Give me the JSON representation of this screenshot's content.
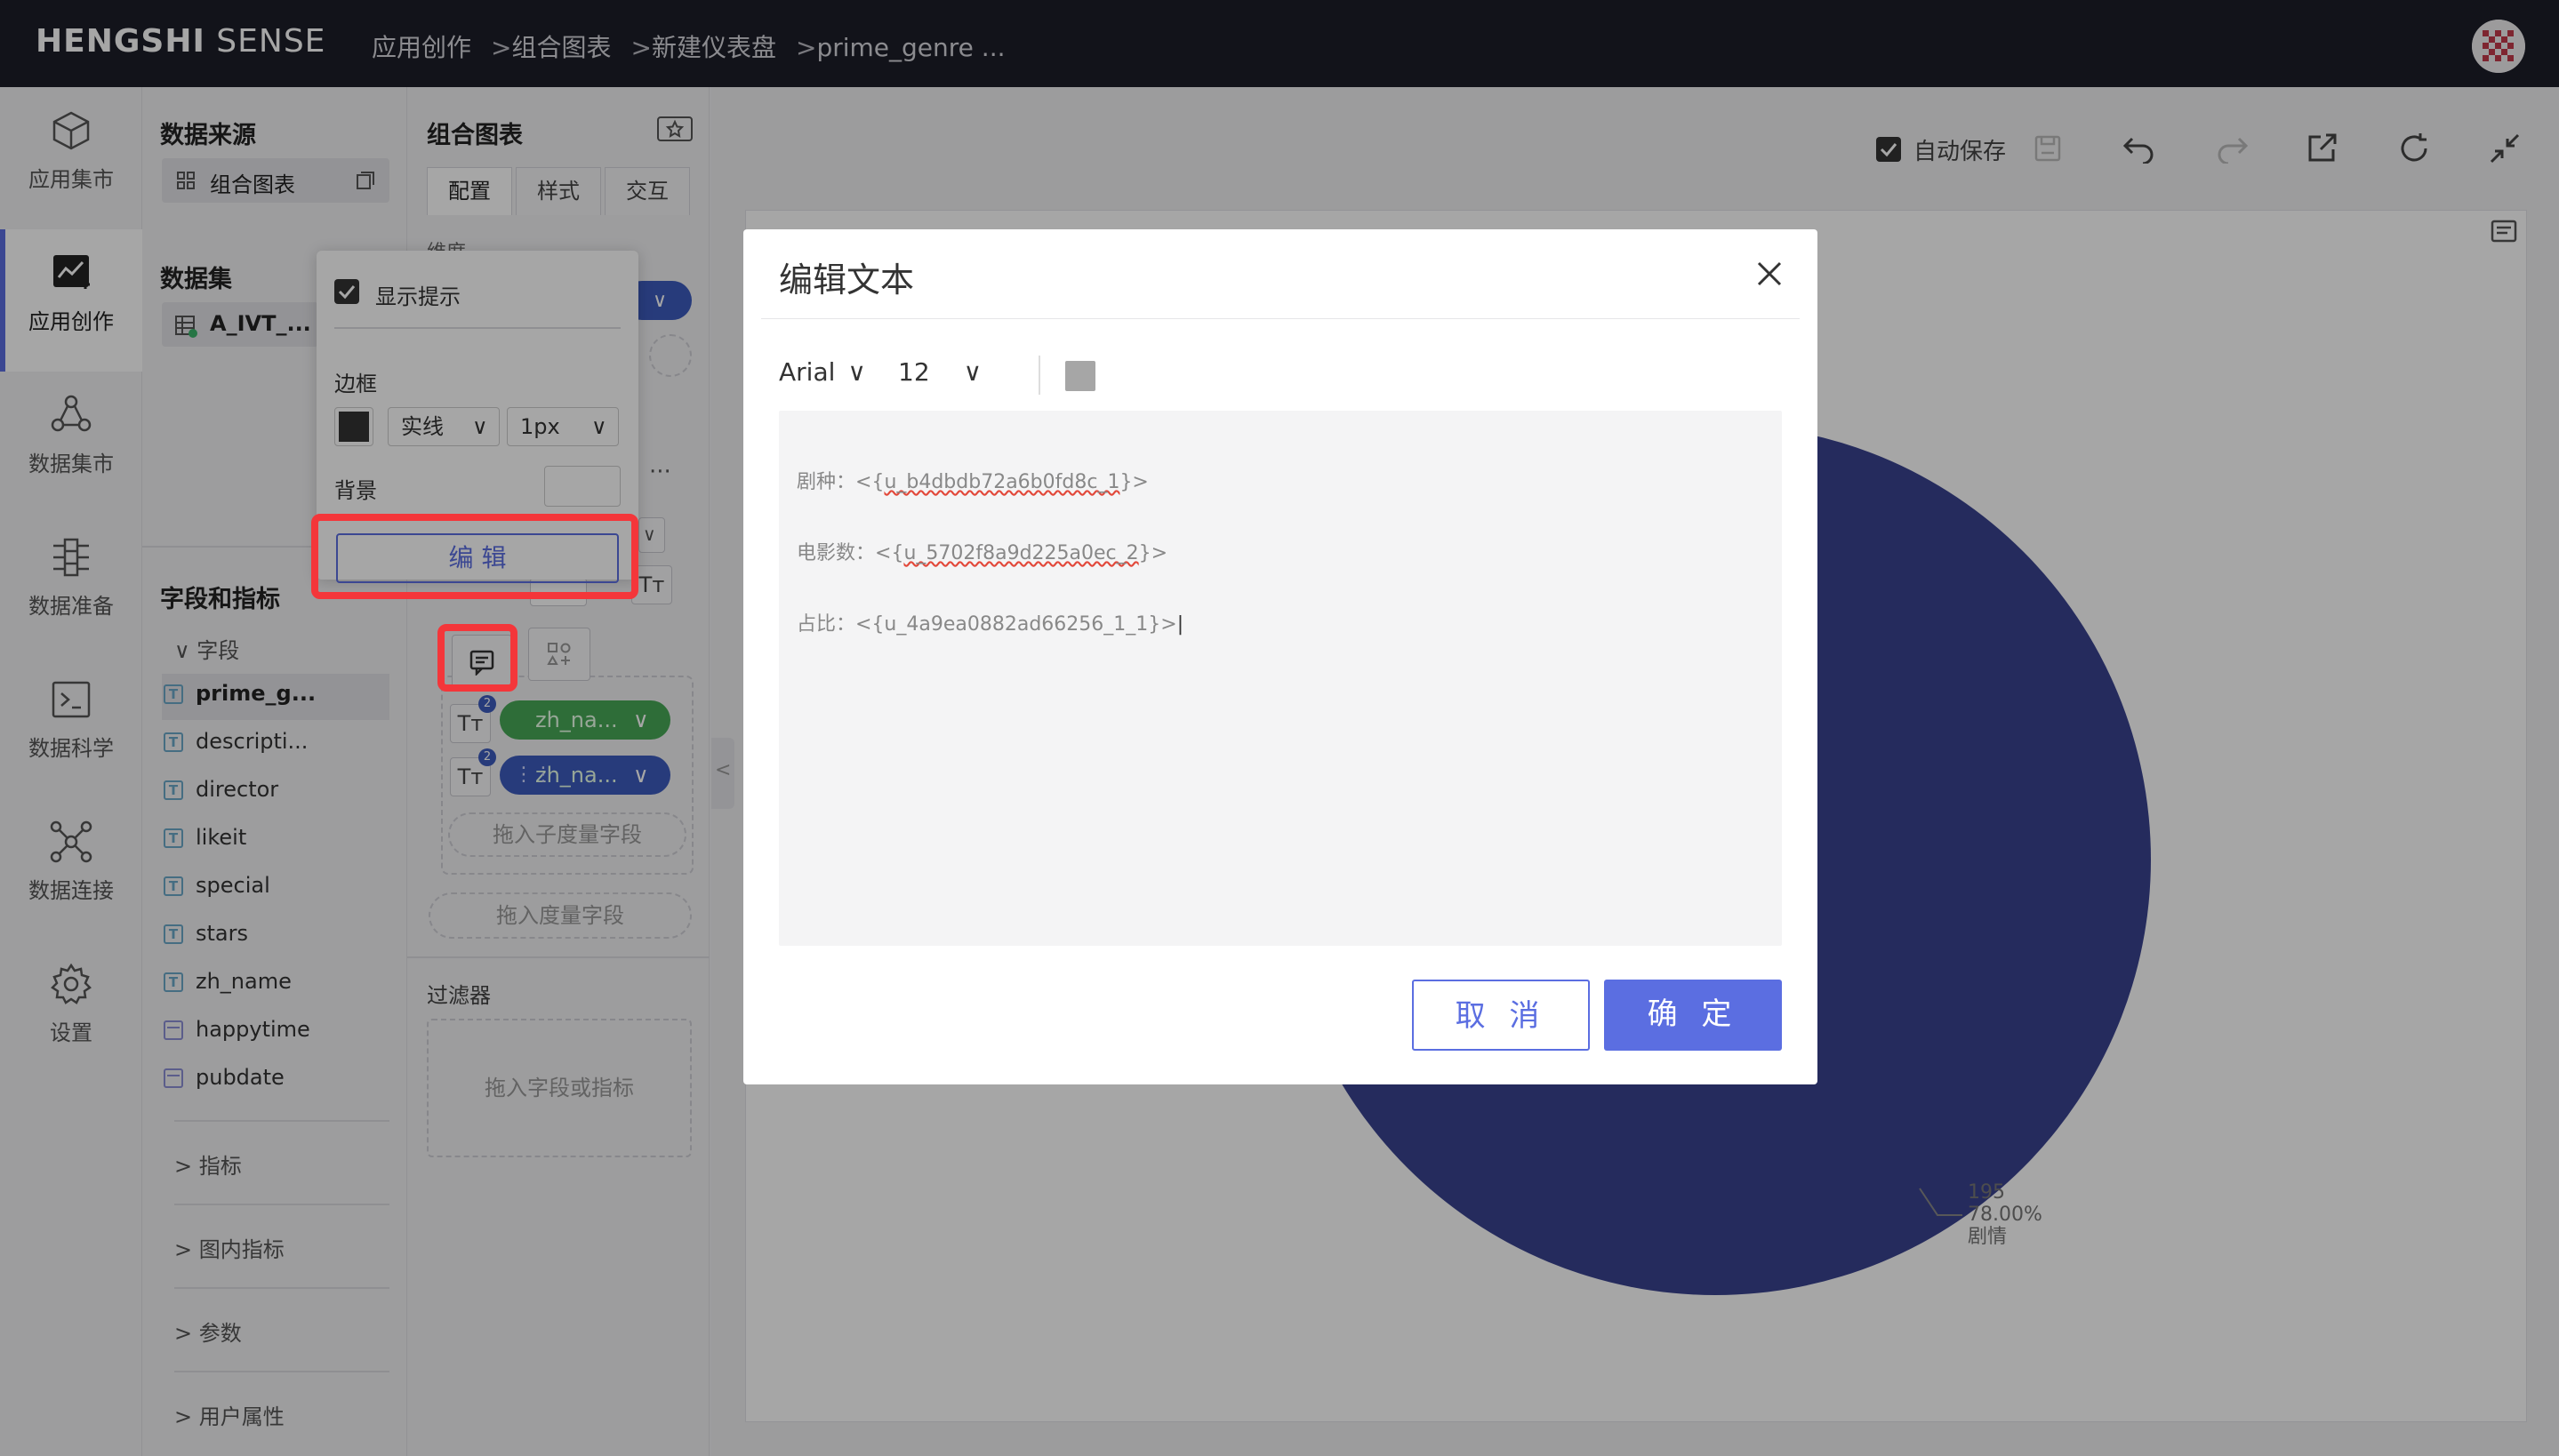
{
  "app": {
    "logo_bold": "HENGSHI",
    "logo_light": " SENSE"
  },
  "breadcrumbs": [
    "应用创作",
    "组合图表",
    "新建仪表盘",
    "prime_genre ..."
  ],
  "breadcrumb_sep": ">",
  "leftnav": {
    "items": [
      {
        "label": "应用集市",
        "icon": "cube-icon"
      },
      {
        "label": "应用创作",
        "icon": "chart-edit-icon",
        "active": true
      },
      {
        "label": "数据集市",
        "icon": "network-icon"
      },
      {
        "label": "数据准备",
        "icon": "data-prep-icon"
      },
      {
        "label": "数据科学",
        "icon": "terminal-icon"
      },
      {
        "label": "数据连接",
        "icon": "connection-icon"
      },
      {
        "label": "设置",
        "icon": "gear-icon"
      }
    ]
  },
  "datapanel": {
    "source_title": "数据来源",
    "source_value": "组合图表",
    "dataset_title": "数据集",
    "dataset_value": "A_IVT_...",
    "fields_title": "字段和指标",
    "fields_group": "字段",
    "fields": [
      {
        "name": "prime_g...",
        "type": "T",
        "selected": true
      },
      {
        "name": "descripti...",
        "type": "T"
      },
      {
        "name": "director",
        "type": "T"
      },
      {
        "name": "likeit",
        "type": "T"
      },
      {
        "name": "special",
        "type": "T"
      },
      {
        "name": "stars",
        "type": "T"
      },
      {
        "name": "zh_name",
        "type": "T"
      },
      {
        "name": "happytime",
        "type": "date"
      },
      {
        "name": "pubdate",
        "type": "date"
      }
    ],
    "groups": [
      "指标",
      "图内指标",
      "参数",
      "用户属性"
    ]
  },
  "cfgpanel": {
    "title": "组合图表",
    "tabs": [
      "配置",
      "样式",
      "交互"
    ],
    "dim_label_partial": "维度",
    "pill_green": "zh_na...",
    "pill_blue": "zh_na...",
    "badge": "2",
    "drop_sub_measure": "拖入子度量字段",
    "drop_measure": "拖入度量字段",
    "filter_title": "过滤器",
    "drop_filter": "拖入字段或指标",
    "more": "···"
  },
  "popover": {
    "show_tip": "显示提示",
    "border_label": "边框",
    "border_style": "实线",
    "border_width": "1px",
    "bg_label": "背景",
    "edit_btn": "编 辑"
  },
  "toolbar": {
    "autosave": "自动保存"
  },
  "chart": {
    "label_value": "195",
    "label_percent": "78.00%",
    "label_name": "剧情",
    "pie_color": "#3a4390"
  },
  "modal": {
    "title": "编辑文本",
    "font": "Arial",
    "size": "12",
    "color_swatch": "#a6a6a6",
    "line1_prefix": "剧种：<{",
    "line1_token": "u_b4dbdb72a6b0fd8c_1",
    "line1_suffix": "}>",
    "line2_prefix": "电影数：<{",
    "line2_token": "u_5702f8a9d225a0ec_2",
    "line2_suffix": "}>",
    "line3": "占比：<{u_4a9ea0882ad66256_1_1}>",
    "cancel": "取 消",
    "confirm": "确 定"
  },
  "colors": {
    "accent": "#5b6ee1",
    "highlight": "#f4363a",
    "topbar": "#1d1e29"
  }
}
